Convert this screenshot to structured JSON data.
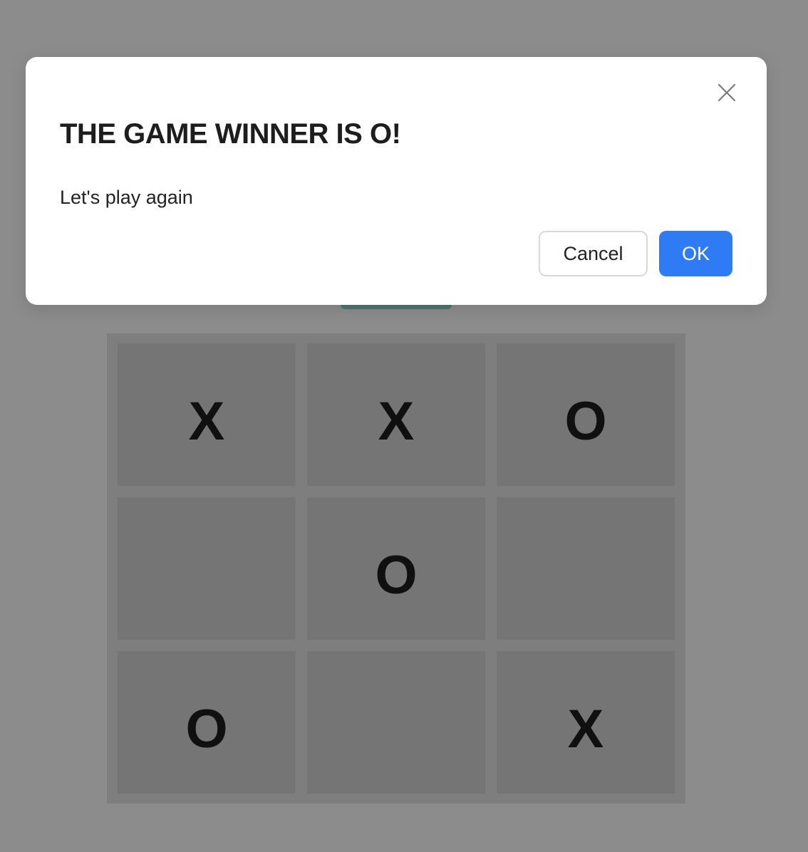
{
  "game": {
    "board": [
      [
        "X",
        "X",
        "O"
      ],
      [
        "",
        "O",
        ""
      ],
      [
        "O",
        "",
        "X"
      ]
    ]
  },
  "modal": {
    "title": "THE GAME WINNER IS O!",
    "message": "Let's play again",
    "cancel_label": "Cancel",
    "ok_label": "OK",
    "close_icon": "close-icon"
  },
  "colors": {
    "overlay": "rgba(0,0,0,0.45)",
    "ok_button": "#2f7bf5",
    "board_cell": "#d6d6d6",
    "reset_button": "#8fd6c9"
  }
}
